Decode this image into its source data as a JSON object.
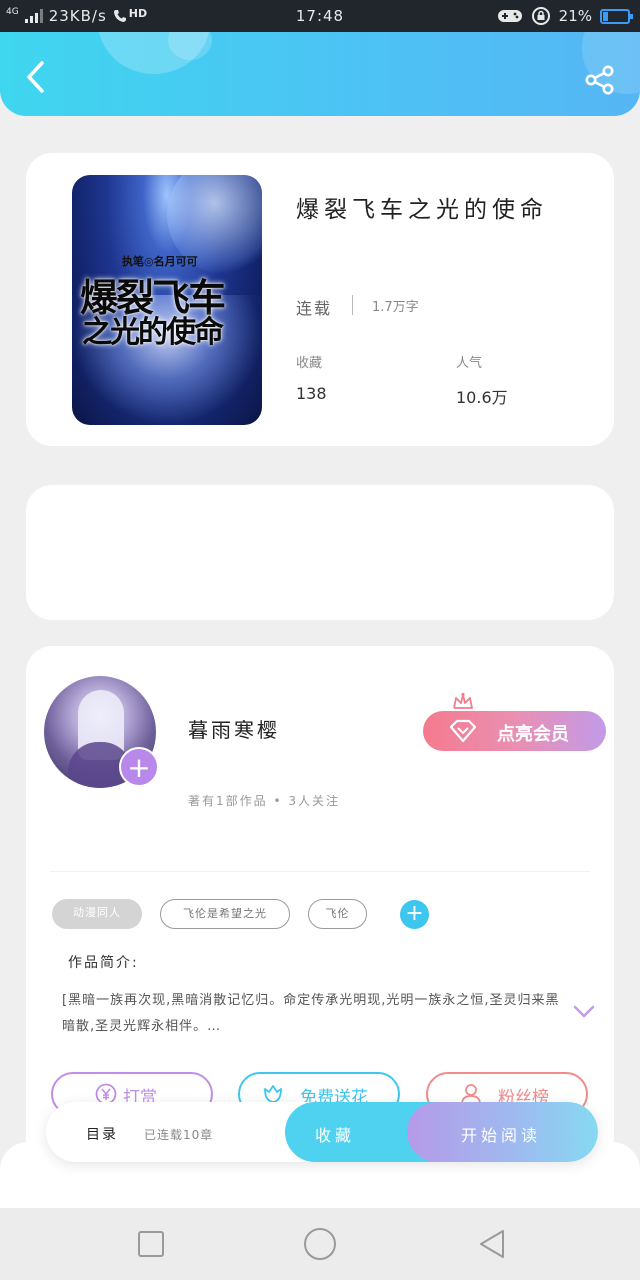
{
  "status_bar": {
    "network": "4G",
    "speed": "23KB/s",
    "call": "HD",
    "time": "17:48",
    "battery": "21%",
    "battery_level": 0.21,
    "icons": [
      "signal-icon",
      "phone-icon",
      "gamepad-icon",
      "rotation-lock-icon",
      "battery-icon"
    ]
  },
  "header": {
    "back_icon": "back-arrow-icon",
    "share_icon": "share-icon",
    "gradient": [
      "#3fd6ef",
      "#55b6f4"
    ]
  },
  "book": {
    "cover_author": "执笔◎名月可可",
    "cover_title_line1": "爆裂飞车",
    "cover_title_line2": "之光的使命",
    "title": "爆裂飞车之光的使命",
    "status": "连载",
    "words": "1.7万字",
    "favorites_label": "收藏",
    "favorites_value": "138",
    "popularity_label": "人气",
    "popularity_value": "10.6万"
  },
  "author": {
    "name": "暮雨寒樱",
    "meta": "著有1部作品 • 3人关注",
    "vip_button": "点亮会员",
    "follow_icon": "plus-icon"
  },
  "tags": [
    "动漫同人",
    "飞伦是希望之光",
    "飞伦"
  ],
  "intro": {
    "label": "作品简介:",
    "text": "[黑暗一族再次现,黑暗消散记忆归。命定传承光明现,光明一族永之恒,圣灵归来黑暗散,圣灵光辉永相伴。…"
  },
  "actions": {
    "reward": "打赏",
    "flower": "免费送花",
    "fans": "粉丝榜"
  },
  "bottom_bar": {
    "toc": "目录",
    "toc_info": "已连载10章",
    "favorite": "收藏",
    "read": "开始阅读"
  },
  "colors": {
    "accent_blue": "#4fd2ef",
    "vip_gradient": [
      "#f47a8e",
      "#c29ae8"
    ],
    "reward": "#c08ee6",
    "flower": "#3fc6ef",
    "fans": "#f28a8a"
  }
}
